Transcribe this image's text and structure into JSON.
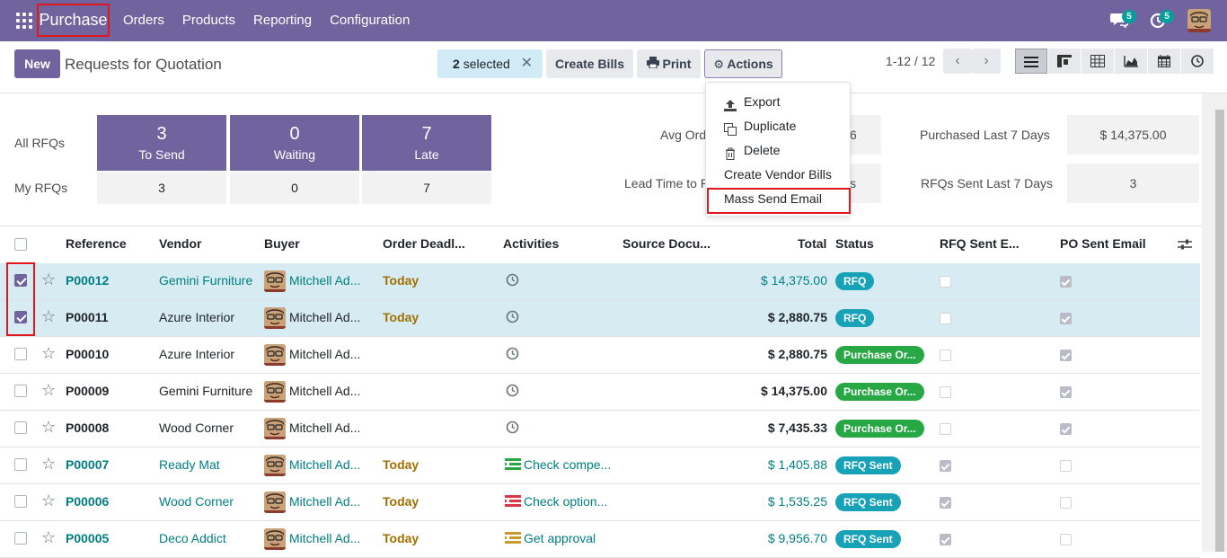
{
  "navbar": {
    "app_name": "Purchase",
    "menu": [
      "Orders",
      "Products",
      "Reporting",
      "Configuration"
    ],
    "messages_count": "5",
    "activities_count": "5",
    "bg_color": "#71639e"
  },
  "control_panel": {
    "new_label": "New",
    "title": "Requests for Quotation",
    "selected_count": "2",
    "selected_text": "selected",
    "create_bills_label": "Create Bills",
    "print_label": "Print",
    "actions_label": "Actions",
    "pager": "1-12 / 12"
  },
  "actions_menu": {
    "items": [
      "Export",
      "Duplicate",
      "Delete",
      "Create Vendor Bills",
      "Mass Send Email"
    ],
    "highlighted": "Mass Send Email"
  },
  "dashboard": {
    "all_rfqs_label": "All RFQs",
    "my_rfqs_label": "My RFQs",
    "tiles": [
      {
        "count": "3",
        "label": "To Send",
        "mine": "3"
      },
      {
        "count": "0",
        "label": "Waiting",
        "mine": "0"
      },
      {
        "count": "7",
        "label": "Late",
        "mine": "7"
      }
    ],
    "avg_order_label": "Avg Ord",
    "avg_order_value": "6",
    "lead_time_label": "Lead Time to P",
    "lead_time_value": "s",
    "purchased_label": "Purchased Last 7 Days",
    "purchased_value": "$ 14,375.00",
    "rfqs_sent_label": "RFQs Sent Last 7 Days",
    "rfqs_sent_value": "3"
  },
  "list": {
    "headers": {
      "reference": "Reference",
      "vendor": "Vendor",
      "buyer": "Buyer",
      "deadline": "Order Deadl...",
      "activities": "Activities",
      "source": "Source Docu...",
      "total": "Total",
      "status": "Status",
      "rfq_sent": "RFQ Sent E...",
      "po_sent": "PO Sent Email"
    },
    "rows": [
      {
        "ref": "P00012",
        "vendor": "Gemini Furniture",
        "buyer": "Mitchell Ad...",
        "deadline": "Today",
        "activity": "",
        "total": "$ 14,375.00",
        "status": "RFQ"
      },
      {
        "ref": "P00011",
        "vendor": "Azure Interior",
        "buyer": "Mitchell Ad...",
        "deadline": "Today",
        "activity": "",
        "total": "$ 2,880.75",
        "status": "RFQ"
      },
      {
        "ref": "P00010",
        "vendor": "Azure Interior",
        "buyer": "Mitchell Ad...",
        "deadline": "",
        "activity": "",
        "total": "$ 2,880.75",
        "status": "Purchase Or..."
      },
      {
        "ref": "P00009",
        "vendor": "Gemini Furniture",
        "buyer": "Mitchell Ad...",
        "deadline": "",
        "activity": "",
        "total": "$ 14,375.00",
        "status": "Purchase Or..."
      },
      {
        "ref": "P00008",
        "vendor": "Wood Corner",
        "buyer": "Mitchell Ad...",
        "deadline": "",
        "activity": "",
        "total": "$ 7,435.33",
        "status": "Purchase Or..."
      },
      {
        "ref": "P00007",
        "vendor": "Ready Mat",
        "buyer": "Mitchell Ad...",
        "deadline": "Today",
        "activity": "Check compe...",
        "total": "$ 1,405.88",
        "status": "RFQ Sent"
      },
      {
        "ref": "P00006",
        "vendor": "Wood Corner",
        "buyer": "Mitchell Ad...",
        "deadline": "Today",
        "activity": "Check option...",
        "total": "$ 1,535.25",
        "status": "RFQ Sent"
      },
      {
        "ref": "P00005",
        "vendor": "Deco Addict",
        "buyer": "Mitchell Ad...",
        "deadline": "Today",
        "activity": "Get approval",
        "total": "$ 9,956.70",
        "status": "RFQ Sent"
      }
    ]
  },
  "colors": {
    "accent": "#71639e",
    "link": "#017e84",
    "rfq_badge": "#17a2b8",
    "purchase_badge": "#28a745",
    "today": "#a16f00",
    "highlight_frame": "#e0181e"
  }
}
